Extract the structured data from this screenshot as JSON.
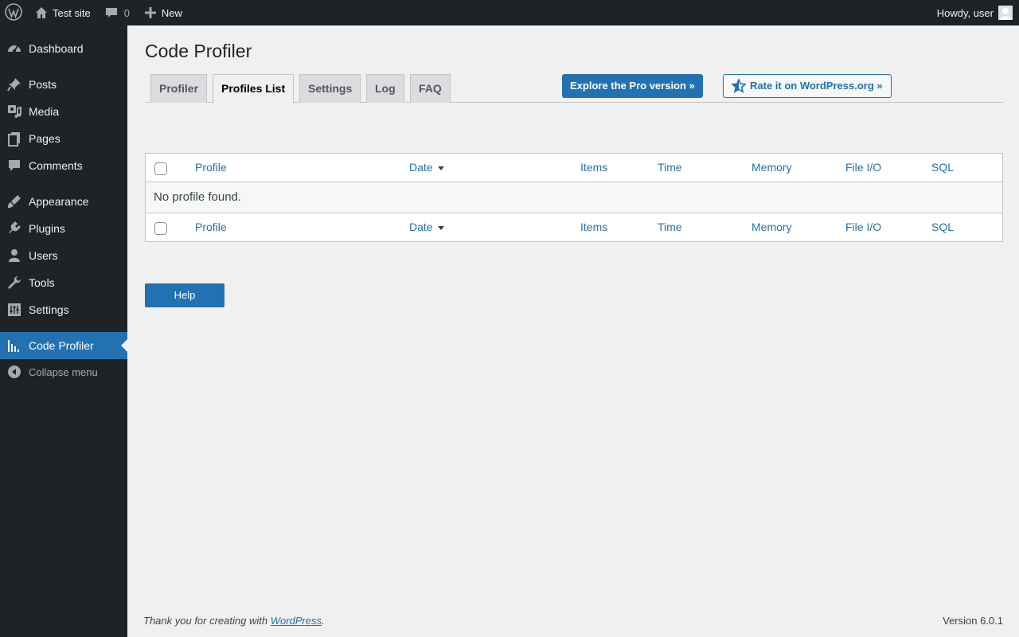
{
  "adminbar": {
    "site_name": "Test site",
    "comments_count": "0",
    "new_label": "New",
    "howdy": "Howdy, user"
  },
  "sidebar": {
    "items": [
      {
        "label": "Dashboard",
        "icon": "dashboard-icon"
      },
      {
        "label": "Posts",
        "icon": "pin-icon"
      },
      {
        "label": "Media",
        "icon": "media-icon"
      },
      {
        "label": "Pages",
        "icon": "pages-icon"
      },
      {
        "label": "Comments",
        "icon": "comment-icon"
      },
      {
        "label": "Appearance",
        "icon": "brush-icon"
      },
      {
        "label": "Plugins",
        "icon": "plug-icon"
      },
      {
        "label": "Users",
        "icon": "user-icon"
      },
      {
        "label": "Tools",
        "icon": "wrench-icon"
      },
      {
        "label": "Settings",
        "icon": "settings-icon"
      },
      {
        "label": "Code Profiler",
        "icon": "chart-icon"
      }
    ],
    "collapse_label": "Collapse menu"
  },
  "page": {
    "title": "Code Profiler",
    "tabs": [
      "Profiler",
      "Profiles List",
      "Settings",
      "Log",
      "FAQ"
    ],
    "active_tab": "Profiles List",
    "pro_button": "Explore the Pro version »",
    "rate_button": "Rate it on WordPress.org »"
  },
  "table": {
    "columns": [
      "Profile",
      "Date",
      "Items",
      "Time",
      "Memory",
      "File I/O",
      "SQL"
    ],
    "empty_message": "No profile found."
  },
  "help_button": "Help",
  "footer": {
    "thanks_prefix": "Thank you for creating with ",
    "thanks_link": "WordPress",
    "thanks_suffix": ".",
    "version": "Version 6.0.1"
  },
  "colors": {
    "accent": "#2271b1",
    "adminbar_bg": "#1d2327",
    "page_bg": "#f0f0f1"
  }
}
